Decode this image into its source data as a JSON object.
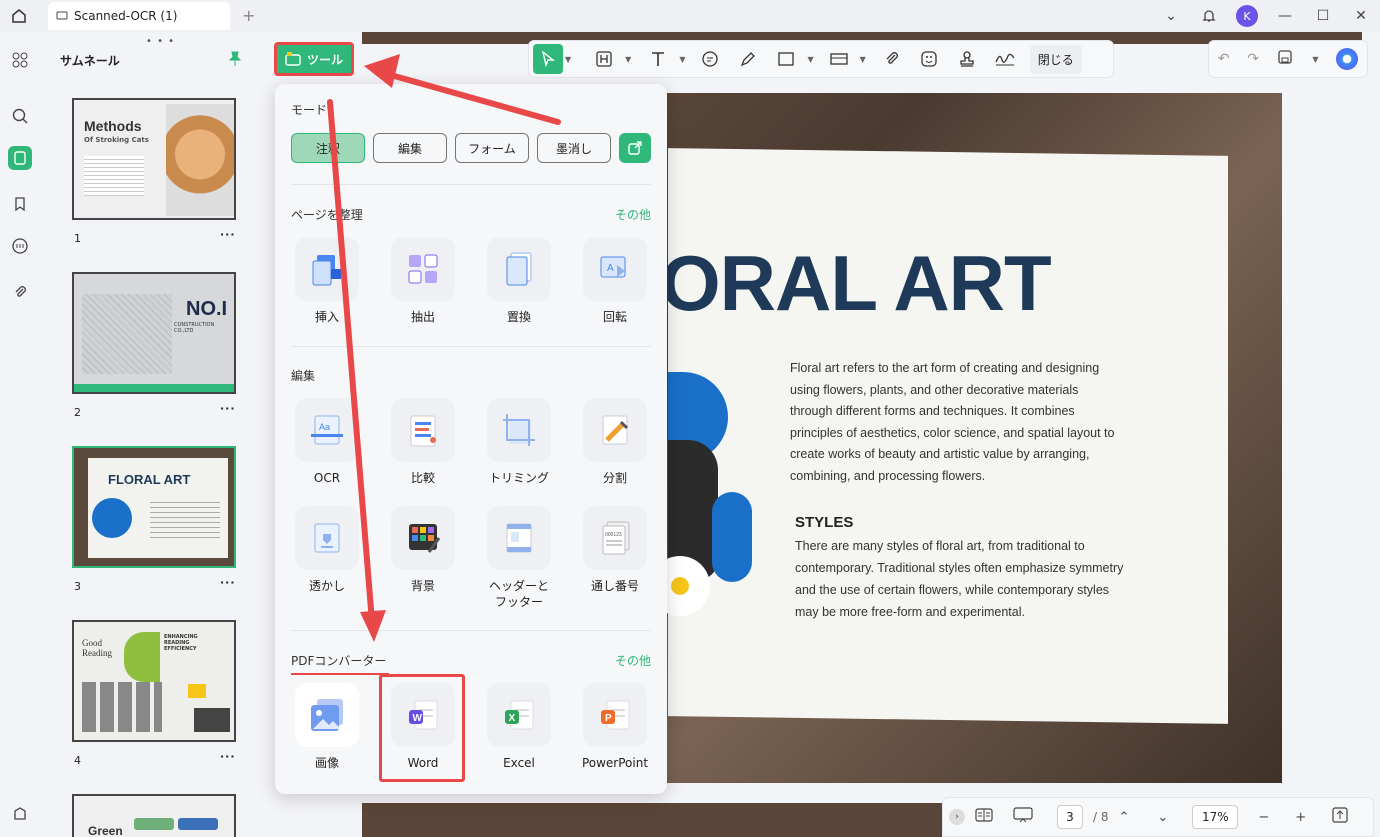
{
  "titlebar": {
    "tab_label": "Scanned-OCR (1)",
    "avatar_initial": "K"
  },
  "thumbnails": {
    "title": "サムネール",
    "pages": [
      {
        "num": "1",
        "caption": "Methods",
        "sub": "Of Stroking Cats"
      },
      {
        "num": "2",
        "caption": "NO.I",
        "sub": "CONSTRUCTION CO.,LTD"
      },
      {
        "num": "3",
        "caption": "FLORAL ART",
        "sub": ""
      },
      {
        "num": "4",
        "caption": "Good Reading",
        "sub": "ENHANCING READING EFFICIENCY"
      },
      {
        "num": "",
        "caption": "Green",
        "sub": ""
      }
    ],
    "more": "···"
  },
  "toolbar": {
    "close_label": "閉じる"
  },
  "tool_button": {
    "label": "ツール"
  },
  "panel": {
    "mode_title": "モード",
    "modes": [
      "注釈",
      "編集",
      "フォーム",
      "墨消し"
    ],
    "organize_title": "ページを整理",
    "more_label": "その他",
    "organize_items": [
      "挿入",
      "抽出",
      "置換",
      "回転"
    ],
    "edit_title": "編集",
    "edit_items": [
      "OCR",
      "比較",
      "トリミング",
      "分割",
      "透かし",
      "背景",
      "ヘッダーと\nフッター",
      "通し番号"
    ],
    "converter_title": "PDFコンバーター",
    "converter_items": [
      "画像",
      "Word",
      "Excel",
      "PowerPoint"
    ]
  },
  "document": {
    "title": "ORAL ART",
    "paragraph": "Floral art refers to the art form of creating and designing using flowers, plants, and other decorative materials through different forms and techniques.  It combines principles of aesthetics, color science, and spatial layout to create works of beauty and artistic value by arranging, combining, and processing flowers.",
    "styles_heading": "STYLES",
    "styles_paragraph": " There are many styles of floral art, from traditional to contemporary. Traditional styles often emphasize symmetry and the use of certain flowers, while contemporary styles may be more free-form and experimental."
  },
  "navbar": {
    "page_current": "3",
    "page_total": "/ 8",
    "zoom": "17%"
  },
  "colors": {
    "accent": "#2fb879",
    "highlight_red": "#e84848",
    "doc_title": "#1f3a58"
  }
}
